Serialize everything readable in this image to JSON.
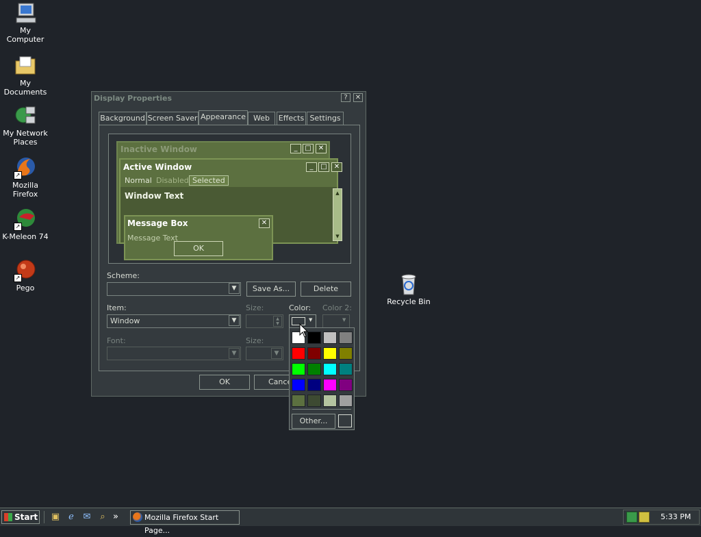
{
  "desktop": {
    "icons": [
      {
        "label_line1": "My Computer",
        "label_line2": "",
        "icon": "my-computer-icon"
      },
      {
        "label_line1": "My Documents",
        "label_line2": "",
        "icon": "my-documents-icon"
      },
      {
        "label_line1": "My Network",
        "label_line2": "Places",
        "icon": "network-places-icon"
      },
      {
        "label_line1": "Mozilla Firefox",
        "label_line2": "",
        "icon": "firefox-icon"
      },
      {
        "label_line1": "K-Meleon 74",
        "label_line2": "",
        "icon": "kmeleon-icon"
      },
      {
        "label_line1": "Pego",
        "label_line2": "",
        "icon": "pego-icon"
      }
    ],
    "recycle_bin": {
      "label": "Recycle Bin",
      "icon": "recycle-bin-icon"
    }
  },
  "dialog": {
    "title": "Display Properties",
    "help_glyph": "?",
    "close_glyph": "✕",
    "tabs": [
      "Background",
      "Screen Saver",
      "Appearance",
      "Web",
      "Effects",
      "Settings"
    ],
    "active_tab": "Appearance",
    "preview": {
      "inactive_title": "Inactive Window",
      "active_title": "Active Window",
      "menu": [
        "Normal",
        "Disabled",
        "Selected"
      ],
      "window_text": "Window Text",
      "message_box_title": "Message Box",
      "message_text": "Message Text",
      "ok": "OK"
    },
    "scheme_label": "Scheme:",
    "scheme_value": "",
    "save_as": "Save As...",
    "delete": "Delete",
    "item_label": "Item:",
    "item_value": "Window",
    "size_label": "Size:",
    "color_label": "Color:",
    "color2_label": "Color 2:",
    "font_label": "Font:",
    "font_size_label": "Size:",
    "ok": "OK",
    "cancel": "Cance"
  },
  "palette": {
    "colors": [
      "#ffffff",
      "#000000",
      "#c0c0c0",
      "#808080",
      "#ff0000",
      "#800000",
      "#ffff00",
      "#808000",
      "#00ff00",
      "#008000",
      "#00ffff",
      "#008080",
      "#0000ff",
      "#000080",
      "#ff00ff",
      "#800080",
      "#5c7040",
      "#3d4a32",
      "#b4c4a0",
      "#a0a0a0"
    ],
    "other": "Other...",
    "current_color": "#343a3e"
  },
  "taskbar": {
    "start": "Start",
    "quicklaunch": [
      "desktop-icon",
      "ie-icon",
      "outlook-icon",
      "search-icon"
    ],
    "chevron": "»",
    "task": "Mozilla Firefox Start Page...",
    "time": "5:33 PM"
  }
}
